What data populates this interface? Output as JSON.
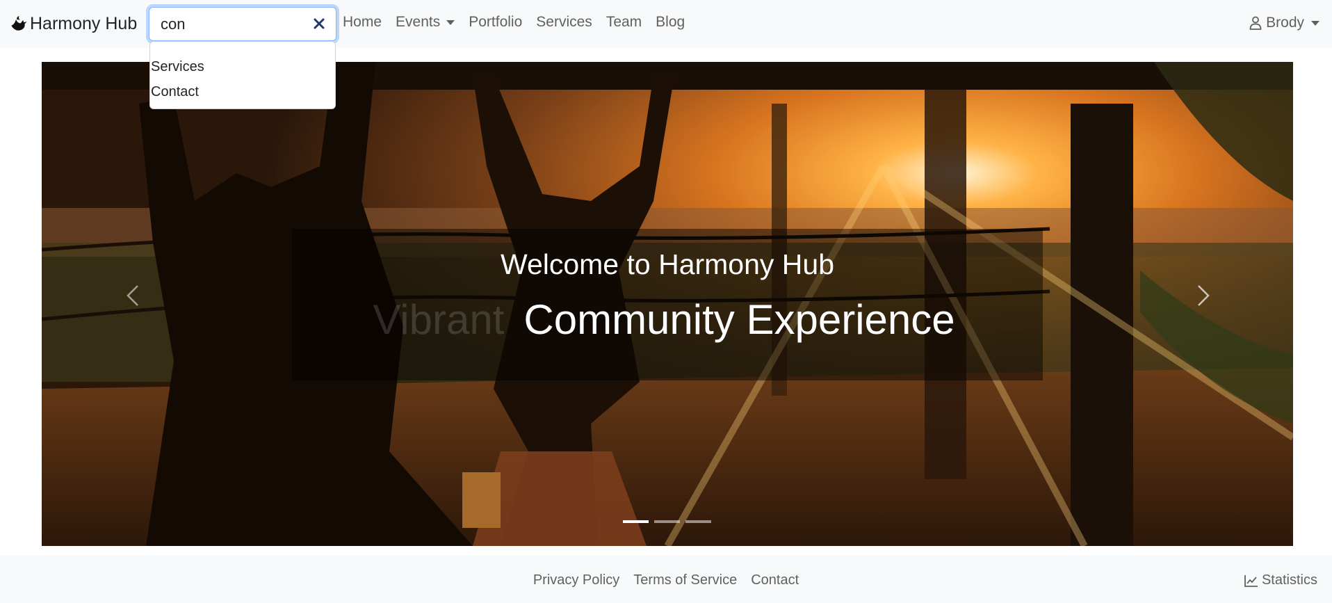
{
  "navbar": {
    "brand": "Harmony Hub",
    "brand_icon": "dove-icon",
    "search": {
      "value": "con",
      "placeholder": ""
    },
    "links": [
      {
        "label": "Home"
      },
      {
        "label": "Events",
        "has_dropdown": true
      },
      {
        "label": "Portfolio"
      },
      {
        "label": "Services"
      },
      {
        "label": "Team"
      },
      {
        "label": "Blog"
      }
    ],
    "user": {
      "name": "Brody",
      "icon": "person-icon"
    }
  },
  "search_suggestions": [
    "Services",
    "Contact"
  ],
  "hero": {
    "title": "Welcome to Harmony Hub",
    "subtitle_previous": "Vibrant",
    "subtitle": "Community Experience",
    "slides": 3,
    "active_slide": 1
  },
  "footer": {
    "links": [
      "Privacy Policy",
      "Terms of Service",
      "Contact"
    ],
    "stats_label": "Statistics"
  },
  "colors": {
    "focus": "#86b7fe",
    "nav_bg": "#f8f9fa",
    "accent": "#e07a1c"
  }
}
